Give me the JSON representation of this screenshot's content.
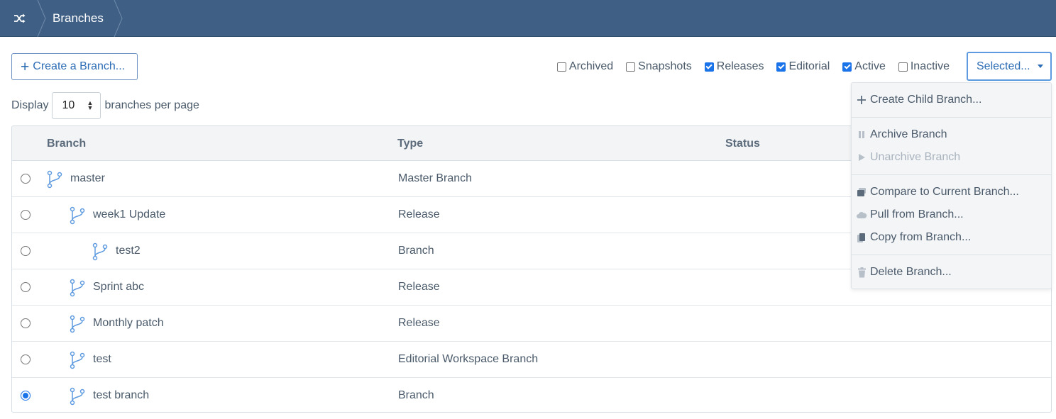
{
  "header": {
    "home_icon": "shuffle-icon",
    "breadcrumb": "Branches"
  },
  "toolbar": {
    "create_label": "Create a Branch...",
    "selected_label": "Selected...",
    "filters": [
      {
        "label": "Archived",
        "checked": false
      },
      {
        "label": "Snapshots",
        "checked": false
      },
      {
        "label": "Releases",
        "checked": true
      },
      {
        "label": "Editorial",
        "checked": true
      },
      {
        "label": "Active",
        "checked": true
      },
      {
        "label": "Inactive",
        "checked": false
      }
    ]
  },
  "pagination": {
    "prefix": "Display",
    "value": "10",
    "suffix": "branches per page"
  },
  "table": {
    "columns": [
      "Branch",
      "Type",
      "Status"
    ],
    "rows": [
      {
        "name": "master",
        "type": "Master Branch",
        "level": 0,
        "selected": false
      },
      {
        "name": "week1 Update",
        "type": "Release",
        "level": 1,
        "selected": false
      },
      {
        "name": "test2",
        "type": "Branch",
        "level": 2,
        "selected": false
      },
      {
        "name": "Sprint abc",
        "type": "Release",
        "level": 1,
        "selected": false
      },
      {
        "name": "Monthly patch",
        "type": "Release",
        "level": 1,
        "selected": false
      },
      {
        "name": "test",
        "type": "Editorial Workspace Branch",
        "level": 1,
        "selected": false
      },
      {
        "name": "test branch",
        "type": "Branch",
        "level": 1,
        "selected": true
      }
    ]
  },
  "menu": {
    "items": [
      {
        "label": "Create Child Branch...",
        "icon": "plus-icon",
        "disabled": false
      },
      {
        "label": "Archive Branch",
        "icon": "pause-icon",
        "disabled": false
      },
      {
        "label": "Unarchive Branch",
        "icon": "play-icon",
        "disabled": true
      },
      {
        "label": "Compare to Current Branch...",
        "icon": "compare-icon",
        "disabled": false
      },
      {
        "label": "Pull from Branch...",
        "icon": "cloud-icon",
        "disabled": false
      },
      {
        "label": "Copy from Branch...",
        "icon": "copy-icon",
        "disabled": false
      },
      {
        "label": "Delete Branch...",
        "icon": "trash-icon",
        "disabled": false
      }
    ]
  },
  "colors": {
    "header_bg": "#3f5f85",
    "accent": "#2d6db5",
    "branch_icon": "#5d9ae0"
  }
}
